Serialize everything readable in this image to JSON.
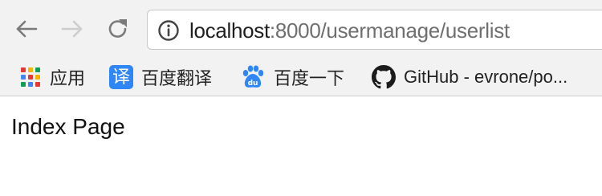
{
  "toolbar": {
    "back_icon": "arrow-left-icon",
    "forward_icon": "arrow-right-icon",
    "reload_icon": "reload-icon",
    "address_bar": {
      "info_icon": "info-circle-icon",
      "host": "localhost",
      "rest": ":8000/usermanage/userlist"
    }
  },
  "bookmarks": {
    "items": [
      {
        "label": "应用",
        "icon": "apps-grid-icon"
      },
      {
        "label": "百度翻译",
        "icon": "baidu-translate-icon",
        "icon_text": "译"
      },
      {
        "label": "百度一下",
        "icon": "baidu-paw-icon"
      },
      {
        "label": "GitHub - evrone/po...",
        "icon": "github-icon"
      }
    ]
  },
  "page": {
    "heading": "Index Page"
  },
  "colors": {
    "toolbar_bg": "#f2f2f2",
    "baidu_blue": "#2f86f6",
    "url_host": "#1f1f1f",
    "url_rest": "#6f6f6f",
    "apps_red": "#e53935",
    "apps_yellow": "#f4b400",
    "apps_green": "#0f9d58",
    "apps_blue": "#4285f4"
  }
}
